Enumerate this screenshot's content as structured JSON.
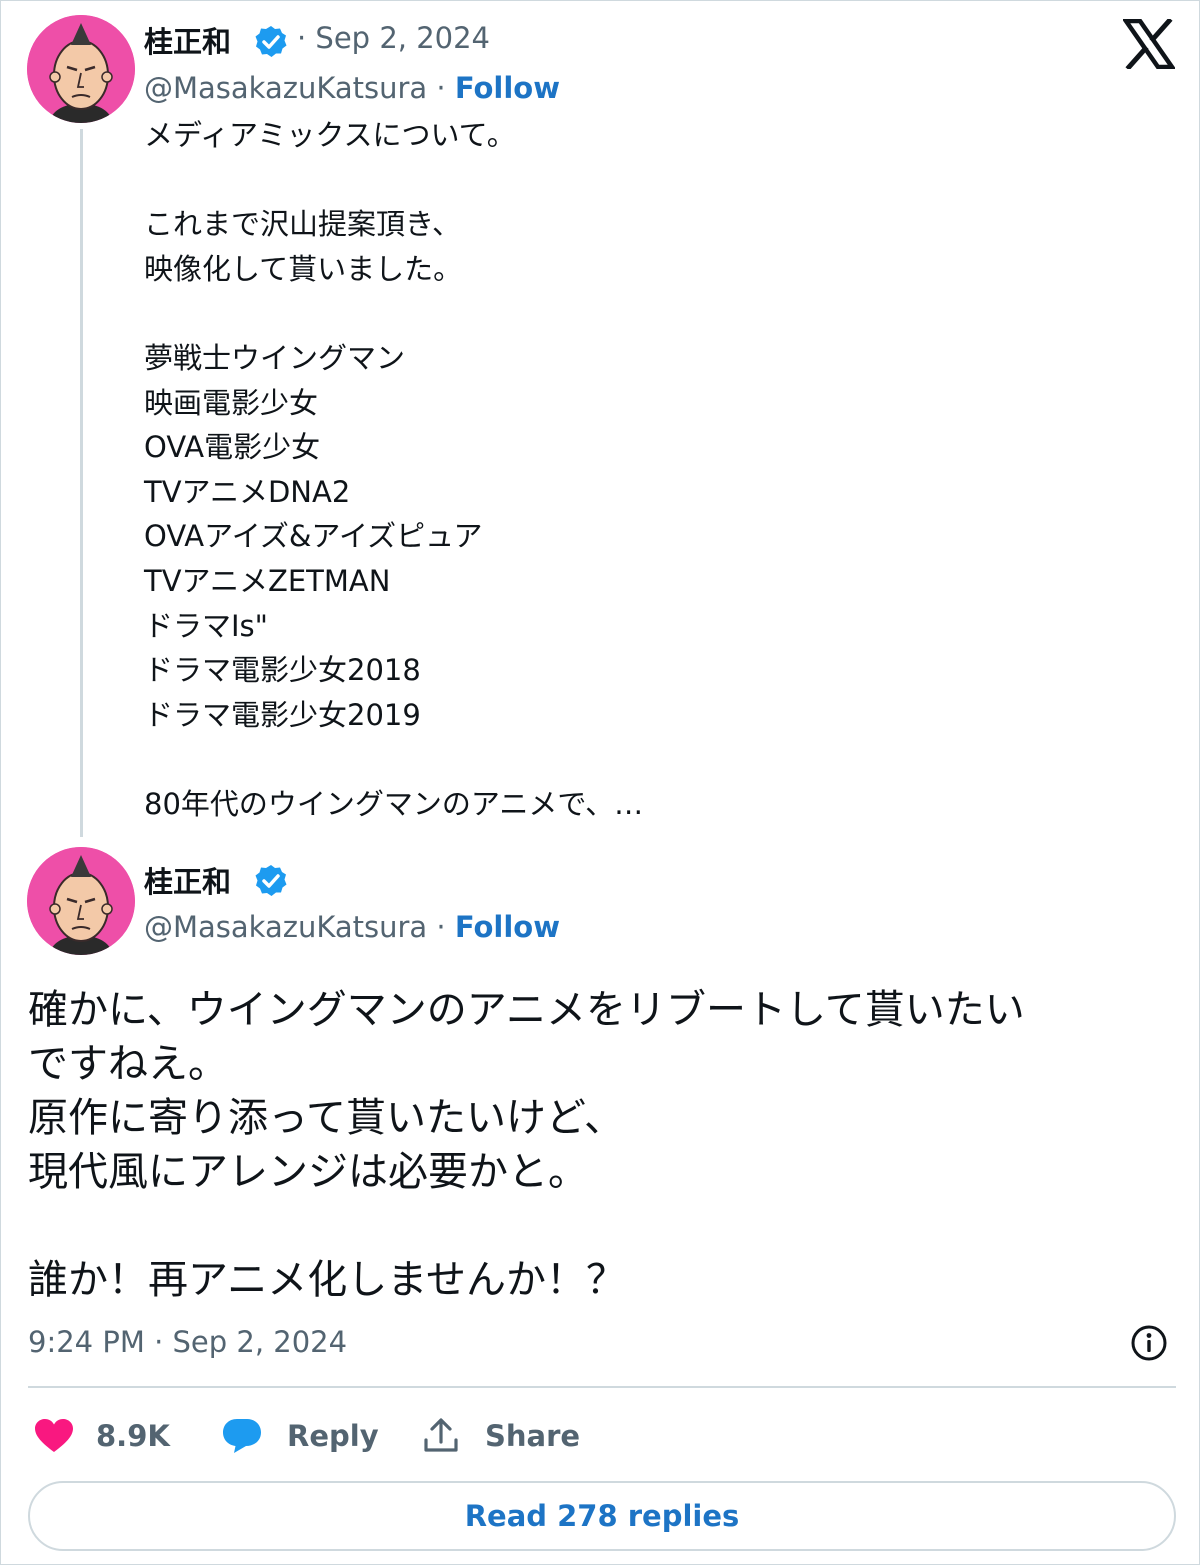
{
  "quoted_tweet": {
    "author_name": "桂正和",
    "date": "· Sep 2, 2024",
    "handle": "@MasakazuKatsura",
    "separator": " · ",
    "follow_label": "Follow",
    "lines": [
      "メディアミックスについて。",
      "",
      "これまで沢山提案頂き、",
      "映像化して貰いました。",
      "",
      "夢戦士ウイングマン",
      "映画電影少女",
      "OVA電影少女",
      "TVアニメDNA2",
      "OVAアイズ&アイズピュア",
      "TVアニメZETMAN",
      "ドラマIs\"",
      "ドラマ電影少女2018",
      "ドラマ電影少女2019",
      "",
      "80年代のウイングマンのアニメで、…"
    ]
  },
  "main_tweet": {
    "author_name": "桂正和",
    "handle": "@MasakazuKatsura",
    "separator": " · ",
    "follow_label": "Follow",
    "lines": [
      "確かに、ウイングマンのアニメをリブートして貰いたい",
      "ですねえ。",
      "原作に寄り添って貰いたいけど、",
      "現代風にアレンジは必要かと。",
      "",
      "誰か！再アニメ化しませんか！？"
    ],
    "timestamp": "9:24 PM · Sep 2, 2024"
  },
  "actions": {
    "like_count": "8.9K",
    "reply_label": "Reply",
    "share_label": "Share"
  },
  "read_replies_label": "Read 278 replies",
  "icons": {
    "platform_logo": "x-logo-icon",
    "verified": "verified-badge-icon",
    "like": "heart-icon",
    "reply": "speech-bubble-icon",
    "share": "share-upload-icon",
    "info": "info-icon"
  },
  "colors": {
    "avatar_background": "#ee4fa8",
    "verified_badge": "#1d9bf0",
    "follow_link": "#1d74c5",
    "like_heart": "#f91880",
    "reply_bubble": "#1d9bf0",
    "muted_text": "#536471",
    "border": "#cfd9de"
  }
}
